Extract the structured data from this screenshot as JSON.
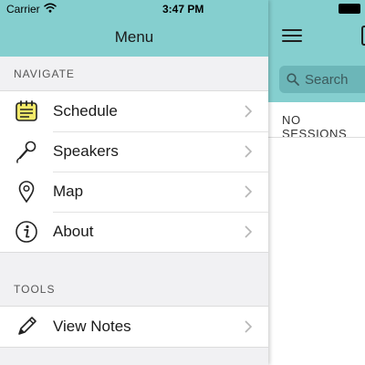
{
  "status_bar": {
    "carrier": "Carrier",
    "time": "3:47 PM"
  },
  "menu": {
    "title": "Menu",
    "sections": [
      {
        "label": "NAVIGATE",
        "items": [
          {
            "label": "Schedule",
            "icon": "calendar-icon"
          },
          {
            "label": "Speakers",
            "icon": "microphone-icon"
          },
          {
            "label": "Map",
            "icon": "map-pin-icon"
          },
          {
            "label": "About",
            "icon": "info-icon"
          }
        ]
      },
      {
        "label": "TOOLS",
        "items": [
          {
            "label": "View Notes",
            "icon": "pencil-icon"
          }
        ]
      }
    ]
  },
  "main": {
    "search_placeholder": "Search",
    "empty_message": "NO SESSIONS"
  },
  "colors": {
    "header_teal": "#85cfcf",
    "search_field": "#6cb6b8",
    "menu_background": "#f1f1f3",
    "schedule_icon_fill": "#f3ea6a"
  }
}
